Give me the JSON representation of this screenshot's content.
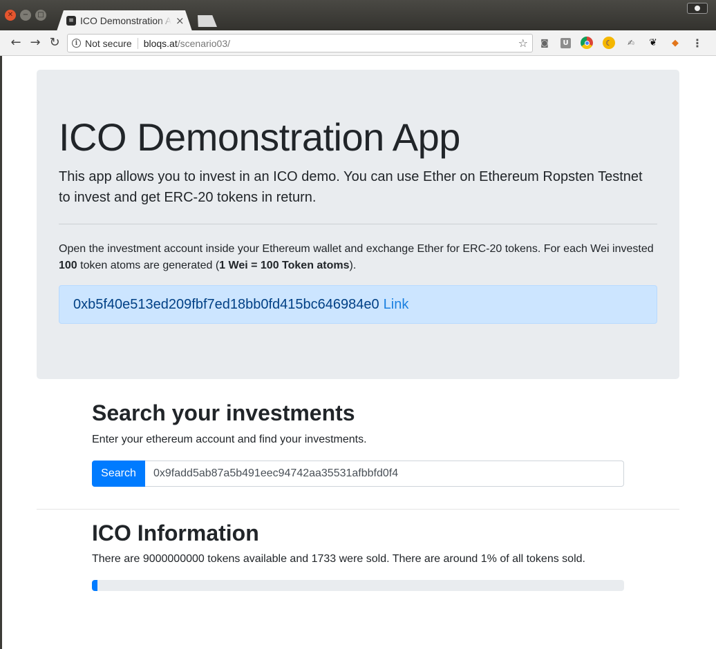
{
  "browser": {
    "tab_title": "ICO Demonstration App",
    "tab_close": "×",
    "security_label": "Not secure",
    "url_host": "bloqs.at",
    "url_path": "/scenario03/",
    "extensions": [
      "camera-icon",
      "ublock-icon",
      "chrome-icon",
      "moon-icon",
      "signature-icon",
      "gnome-icon",
      "metamask-icon",
      "menu-icon"
    ]
  },
  "jumbotron": {
    "title": "ICO Demonstration App",
    "lead": "This app allows you to invest in an ICO demo. You can use Ether on Ethereum Ropsten Testnet to invest and get ERC-20 tokens in return.",
    "info_part1": "Open the investment account inside your Ethereum wallet and exchange Ether for ERC-20 tokens. For each Wei invested ",
    "info_bold1": "100",
    "info_part2": " token atoms are generated (",
    "info_bold2": "1 Wei = 100 Token atoms",
    "info_part3": ").",
    "contract_address": "0xb5f40e513ed209fbf7ed18bb0fd415bc646984e0",
    "link_label": "Link"
  },
  "search": {
    "title": "Search your investments",
    "description": "Enter your ethereum account and find your investments.",
    "button_label": "Search",
    "input_value": "0x9fadd5ab87a5b491eec94742aa35531afbbfd0f4"
  },
  "ico_info": {
    "title": "ICO Information",
    "text": "There are 9000000000 tokens available and 1733 were sold. There are around 1% of all tokens sold.",
    "progress_percent": 1
  },
  "colors": {
    "primary": "#007bff",
    "jumbotron_bg": "#e9ecef",
    "alert_bg": "#cce5ff",
    "alert_text": "#004085"
  }
}
